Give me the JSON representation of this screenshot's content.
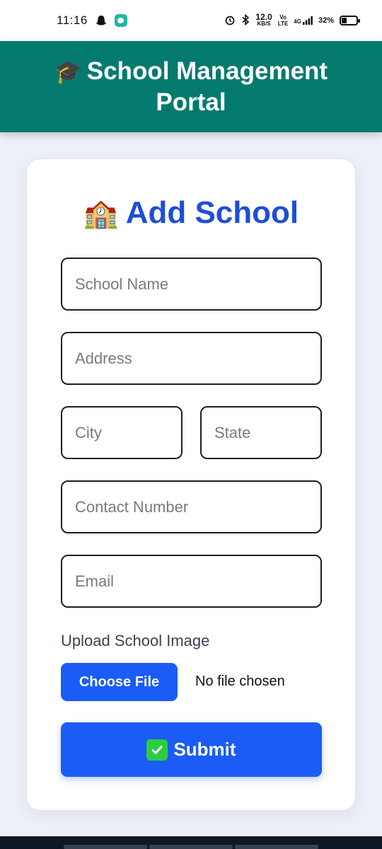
{
  "status_bar": {
    "time": "11:16",
    "speed_value": "12.0",
    "speed_unit": "KB/S",
    "volte_top": "Vo",
    "volte_bottom": "LTE",
    "network": "4G",
    "battery": "32%",
    "icons": [
      "snapchat-icon",
      "message-icon",
      "alarm-icon",
      "bluetooth-icon",
      "signal-icon",
      "battery-icon"
    ]
  },
  "header": {
    "title": "School Management Portal",
    "emoji": "🎓"
  },
  "form": {
    "title": "Add School",
    "title_emoji": "🏫",
    "school_name_placeholder": "School Name",
    "address_placeholder": "Address",
    "city_placeholder": "City",
    "state_placeholder": "State",
    "contact_placeholder": "Contact Number",
    "email_placeholder": "Email",
    "upload_label": "Upload School Image",
    "choose_file_label": "Choose File",
    "file_status": "No file chosen",
    "submit_label": "Submit"
  },
  "colors": {
    "header_bg": "#047a6e",
    "title_blue": "#1d4ed8",
    "button_blue": "#1a5cf5",
    "page_bg": "#eef0f8"
  }
}
